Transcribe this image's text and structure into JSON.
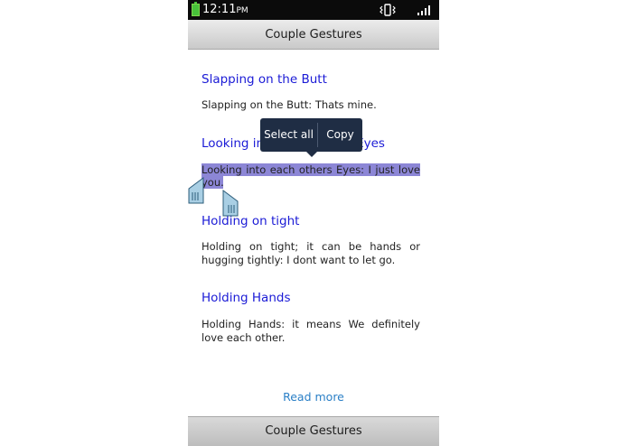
{
  "status_bar": {
    "time": "12:11",
    "ampm": "PM"
  },
  "header": {
    "title": "Couple Gestures"
  },
  "sections": [
    {
      "heading": "Slapping on the Butt",
      "text": "Slapping on the Butt: Thats mine."
    },
    {
      "heading": "Looking into each others Eyes",
      "text": "Looking into each others Eyes: I just love you."
    },
    {
      "heading": "Holding on tight",
      "text": "Holding on tight; it can be hands or hugging tightly: I dont want to let go."
    },
    {
      "heading": "Holding Hands",
      "text": "Holding Hands: it means We definitely love each other."
    }
  ],
  "context_menu": {
    "select_all": "Select all",
    "copy": "Copy"
  },
  "read_more": "Read more",
  "footer": {
    "title": "Couple Gestures"
  },
  "colors": {
    "heading": "#1b1bd6",
    "selection": "#8c86d6",
    "popup": "#1f2d44",
    "link": "#2a7fc6"
  }
}
